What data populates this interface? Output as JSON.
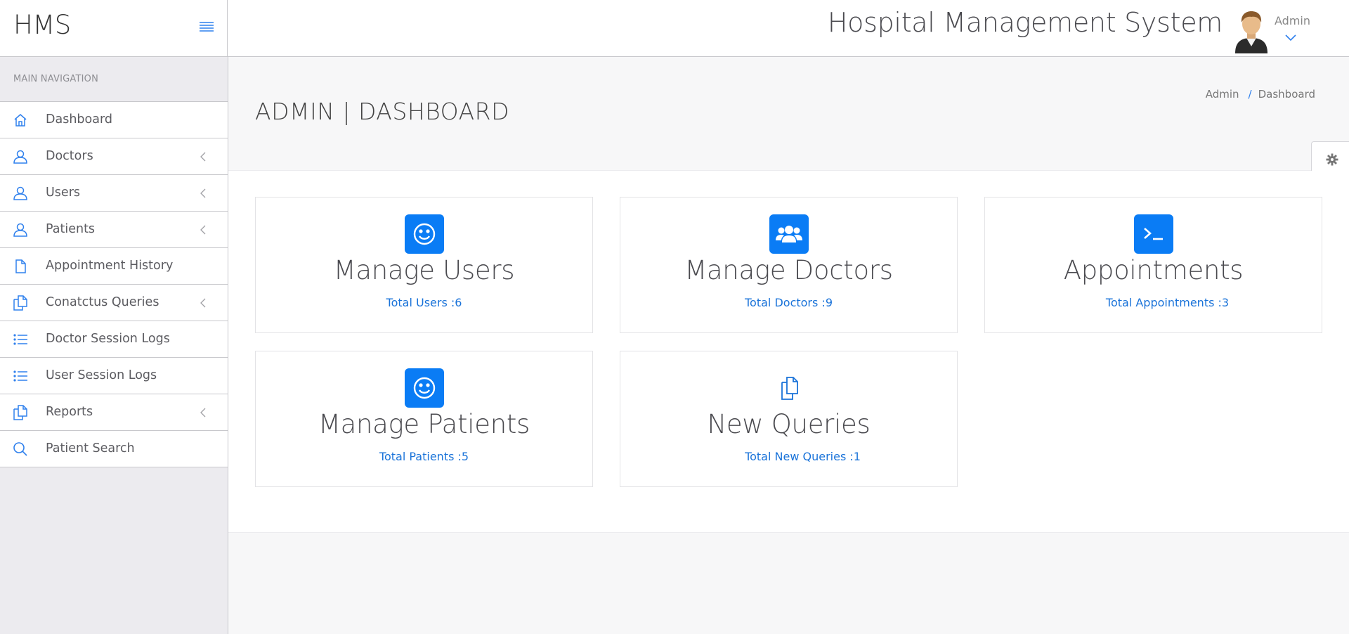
{
  "brand": "HMS",
  "app_title": "Hospital Management System",
  "user": {
    "name": "Admin"
  },
  "sidebar": {
    "heading": "MAIN NAVIGATION",
    "items": [
      {
        "label": "Dashboard",
        "icon": "home-icon",
        "has_submenu": false
      },
      {
        "label": "Doctors",
        "icon": "user-icon",
        "has_submenu": true
      },
      {
        "label": "Users",
        "icon": "user-icon",
        "has_submenu": true
      },
      {
        "label": "Patients",
        "icon": "user-icon",
        "has_submenu": true
      },
      {
        "label": "Appointment History",
        "icon": "file-icon",
        "has_submenu": false
      },
      {
        "label": "Conatctus Queries",
        "icon": "files-icon",
        "has_submenu": true
      },
      {
        "label": "Doctor Session Logs",
        "icon": "list-icon",
        "has_submenu": false
      },
      {
        "label": "User Session Logs",
        "icon": "list-icon",
        "has_submenu": false
      },
      {
        "label": "Reports",
        "icon": "files-icon",
        "has_submenu": true
      },
      {
        "label": "Patient Search",
        "icon": "search-icon",
        "has_submenu": false
      }
    ]
  },
  "page": {
    "title": "ADMIN | DASHBOARD",
    "breadcrumb": [
      "Admin",
      "Dashboard"
    ]
  },
  "cards": [
    {
      "title": "Manage Users",
      "stat": "Total Users :6",
      "icon": "smile-icon"
    },
    {
      "title": "Manage Doctors",
      "stat": "Total Doctors :9",
      "icon": "users-group-icon"
    },
    {
      "title": "Appointments",
      "stat": "Total Appointments :3",
      "icon": "terminal-icon"
    },
    {
      "title": "Manage Patients",
      "stat": "Total Patients :5",
      "icon": "smile-icon"
    },
    {
      "title": "New Queries",
      "stat": "Total New Queries :1",
      "icon": "files-icon"
    }
  ],
  "colors": {
    "accent": "#0a7cf5",
    "link": "#1a73d9",
    "sidebar_bg": "#ecebef"
  }
}
